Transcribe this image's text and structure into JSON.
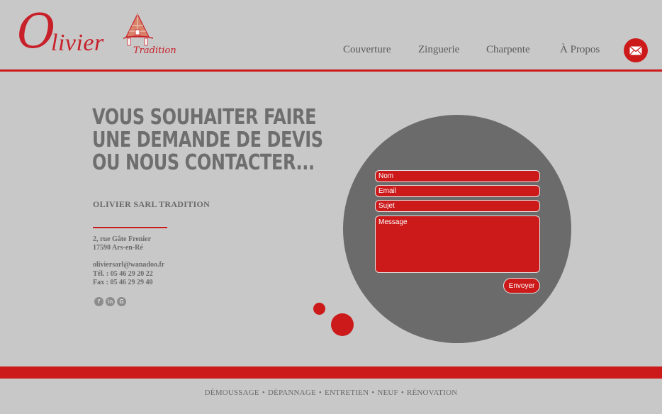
{
  "brand": {
    "initial": "O",
    "word": "livier",
    "tagline": "Tradition",
    "accent_color": "#cc1a1a"
  },
  "nav": {
    "items": [
      "Couverture",
      "Zinguerie",
      "Charpente",
      "À Propos"
    ],
    "mail_icon": "mail-icon"
  },
  "contact": {
    "headline": [
      "VOUS SOUHAITER FAIRE",
      "UNE DEMANDE DE DEVIS",
      "OU NOUS CONTACTER..."
    ],
    "company": "OLIVIER SARL TRADITION",
    "address_line1": "2, rue Gâte Frenier",
    "address_line2": "17590 Ars-en-Ré",
    "email": "oliviersarl@wanadoo.fr",
    "tel": "Tél. : 05 46 29 20 22",
    "fax": "Fax : 05 46 29 29 40",
    "socials": [
      "facebook-icon",
      "linkedin-icon",
      "google-plus-icon"
    ]
  },
  "form": {
    "name_placeholder": "Nom",
    "email_placeholder": "Email",
    "subject_placeholder": "Sujet",
    "message_placeholder": "Message",
    "submit_label": "Envoyer"
  },
  "footer": {
    "services": [
      "DÉMOUSSAGE",
      "DÉPANNAGE",
      "ENTRETIEN",
      "NEUF",
      "RÉNOVATION"
    ]
  }
}
